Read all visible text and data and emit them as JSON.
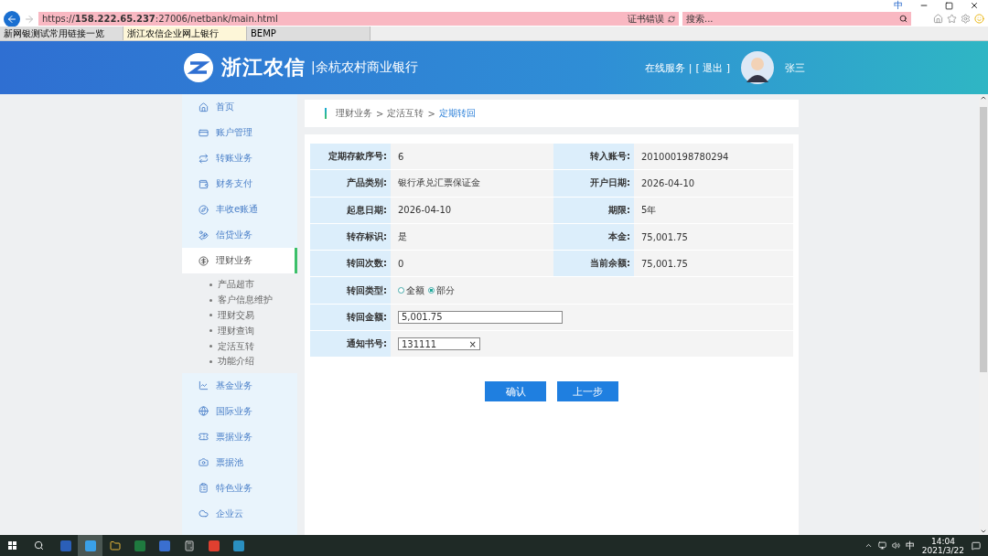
{
  "browser": {
    "url": "https://**158.222.65.237**:27006/netbank/main.html",
    "cert_error": "证书错误",
    "search_placeholder": "搜索...",
    "ime_mode": "中",
    "tabs": [
      {
        "label": "新网银测试常用链接一览",
        "selected": false
      },
      {
        "label": "浙江农信企业网上银行",
        "selected": true
      },
      {
        "label": "BEMP",
        "selected": false
      }
    ]
  },
  "header": {
    "brand": "浙江农信",
    "subtitle": "|余杭农村商业银行",
    "service_link": "在线服务",
    "separator": "|",
    "logout": "[ 退出 ]",
    "user": "张三"
  },
  "sidebar": {
    "items": [
      {
        "label": "首页",
        "kind": "home",
        "selected": false
      },
      {
        "label": "账户管理",
        "kind": "card",
        "selected": false
      },
      {
        "label": "转账业务",
        "kind": "transfer",
        "selected": false
      },
      {
        "label": "财务支付",
        "kind": "wallet",
        "selected": false
      },
      {
        "label": "丰收e账通",
        "kind": "compass",
        "selected": false
      },
      {
        "label": "信贷业务",
        "kind": "loan",
        "selected": false
      },
      {
        "label": "理财业务",
        "kind": "yen",
        "selected": true,
        "expanded": true,
        "children": [
          {
            "label": "产品超市"
          },
          {
            "label": "客户信息维护"
          },
          {
            "label": "理财交易"
          },
          {
            "label": "理财查询"
          },
          {
            "label": "定活互转"
          },
          {
            "label": "功能介绍"
          }
        ]
      },
      {
        "label": "基金业务",
        "kind": "chart",
        "selected": false
      },
      {
        "label": "国际业务",
        "kind": "globe",
        "selected": false
      },
      {
        "label": "票据业务",
        "kind": "ticket",
        "selected": false
      },
      {
        "label": "票据池",
        "kind": "camera",
        "selected": false
      },
      {
        "label": "特色业务",
        "kind": "clipboard",
        "selected": false
      },
      {
        "label": "企业云",
        "kind": "cloud",
        "selected": false
      }
    ]
  },
  "breadcrumb": {
    "items": [
      "理财业务",
      "定活互转",
      "定期转回"
    ],
    "separator": ">"
  },
  "details": [
    {
      "label": "定期存款序号:",
      "value": "6",
      "label_2": "转入账号:",
      "value_2": "201000198780294"
    },
    {
      "label": "产品类别:",
      "value": "银行承兑汇票保证金",
      "label_2": "开户日期:",
      "value_2": "2026-04-10"
    },
    {
      "label": "起息日期:",
      "value": "2026-04-10",
      "label_2": "期限:",
      "value_2": "5年"
    },
    {
      "label": "转存标识:",
      "value": "是",
      "label_2": "本金:",
      "value_2": "75,001.75"
    },
    {
      "label": "转回次数:",
      "value": "0",
      "label_2": "当前余额:",
      "value_2": "75,001.75"
    }
  ],
  "form": {
    "type_label": "转回类型:",
    "type_options": [
      {
        "label": "全额",
        "selected": false
      },
      {
        "label": "部分",
        "selected": true
      }
    ],
    "amount_label": "转回金额:",
    "amount_value": "5,001.75",
    "notice_label": "通知书号:",
    "notice_value": "131111",
    "clear_char": "×"
  },
  "buttons": [
    "确认",
    "上一步"
  ],
  "taskbar": {
    "apps": [
      {
        "kind": "word",
        "selected": false
      },
      {
        "kind": "ie",
        "selected": true
      },
      {
        "kind": "folder",
        "selected": false
      },
      {
        "kind": "excel",
        "selected": false
      },
      {
        "kind": "app",
        "selected": false
      },
      {
        "kind": "calc",
        "selected": false
      },
      {
        "kind": "chrome",
        "selected": false
      },
      {
        "kind": "photo",
        "selected": false
      }
    ],
    "ime": "中",
    "time": "14:04",
    "date": "2021/3/22"
  }
}
